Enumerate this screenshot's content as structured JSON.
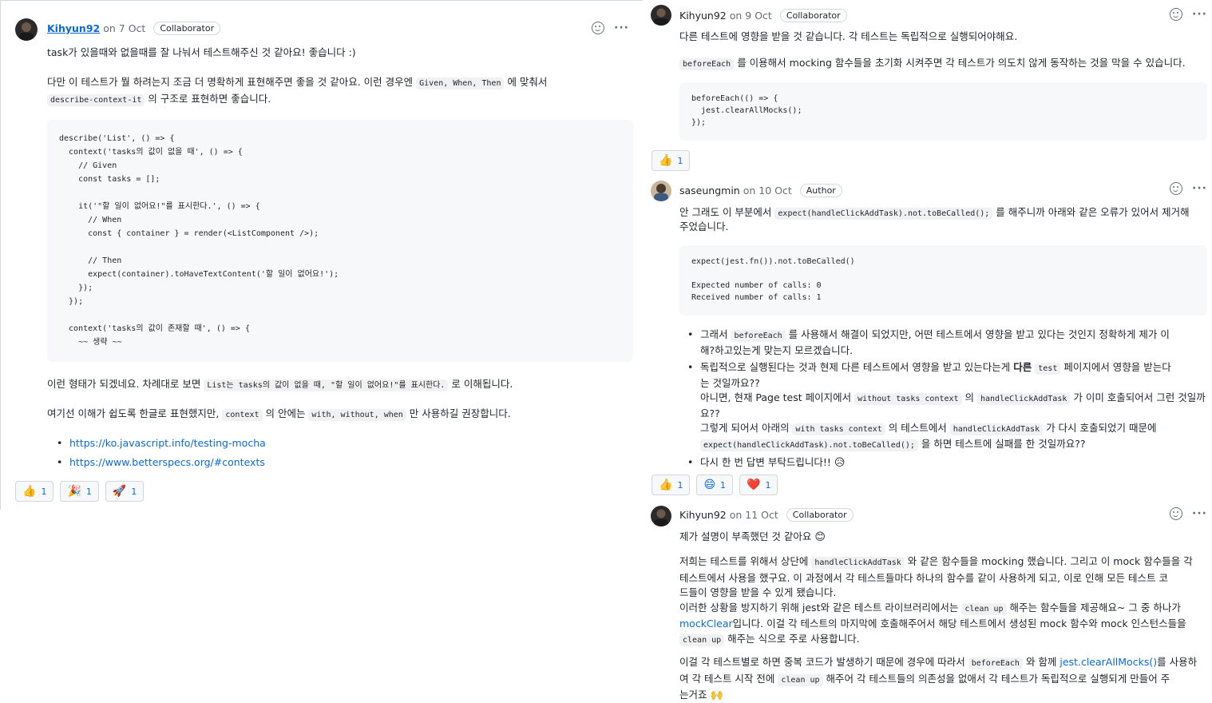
{
  "c1": {
    "author": "Kihyun92",
    "date": "on 7 Oct",
    "role": "Collaborator",
    "p1": "task가 있을때와 없을때를 잘 나눠서 테스트해주신 것 같아요! 좋습니다 :)",
    "p2_a": "다만 이 테스트가 뭘 하려는지 조금 더 명확하게 표현해주면 좋을 것 같아요. 이런 경우엔 ",
    "p2_code": "Given, When, Then",
    "p2_b": " 에 맞춰서",
    "p2_code2": "describe-context-it",
    "p2_c": " 의 구조로 표현하면 좋습니다.",
    "code": "describe('List', () => {\n  context('tasks의 값이 없을 때', () => {\n    // Given\n    const tasks = [];\n\n    it('\"할 일이 없어요!\"를 표시한다.', () => {\n      // When\n      const { container } = render(<ListComponent />);\n\n      // Then\n      expect(container).toHaveTextContent('할 일이 없어요!');\n    });\n  });\n\n  context('tasks의 값이 존재할 때', () => {\n    ~~ 생략 ~~",
    "p3_a": "이런 형태가 되겠네요. 차례대로 보면 ",
    "p3_code": "List는 tasks의 값이 없을 때, \"할 일이 없어요!\"를 표시한다.",
    "p3_b": " 로 이해됩니다.",
    "p4_a": "여기선 이해가 쉽도록 한글로 표현했지만, ",
    "p4_code": "context",
    "p4_b": " 의 안에는 ",
    "p4_code2": "with, without, when",
    "p4_c": " 만 사용하길 권장합니다.",
    "links": [
      "https://ko.javascript.info/testing-mocha",
      "https://www.betterspecs.org/#contexts"
    ],
    "reactions": [
      {
        "emoji": "👍",
        "count": "1"
      },
      {
        "emoji": "🎉",
        "count": "1"
      },
      {
        "emoji": "🚀",
        "count": "1"
      }
    ]
  },
  "c2": {
    "author": "Kihyun92",
    "date": "on 9 Oct",
    "role": "Collaborator",
    "p1": "다른 테스트에 영향을 받을 것 같습니다. 각 테스트는 독립적으로 실행되어야해요.",
    "p2_code": "beforeEach",
    "p2_b": " 를 이용해서 mocking 함수들을 초기화 시켜주면 각 테스트가 의도치 않게 동작하는 것을 막을 수 있습니다.",
    "code": "beforeEach(() => {\n  jest.clearAllMocks();\n});",
    "reactions": [
      {
        "emoji": "👍",
        "count": "1"
      }
    ]
  },
  "c3": {
    "author": "saseungmin",
    "date": "on 10 Oct",
    "role": "Author",
    "p1_a": "안 그래도 이 부분에서 ",
    "p1_code": "expect(handleClickAddTask).not.toBeCalled();",
    "p1_b": " 를 해주니까 아래와 같은 오류가 있어서 제거해",
    "p1_c": "주었습니다.",
    "code": "expect(jest.fn()).not.toBeCalled()\n\nExpected number of calls: 0\nReceived number of calls: 1",
    "b1_a": "그래서 ",
    "b1_code": "beforeEach",
    "b1_b": " 를 사용해서 해결이 되었지만, 어떤 테스트에서 영향을 받고 있다는 것인지 정확하게 제가 이",
    "b1_c": "해?하고있는게 맞는지 모르겠습니다.",
    "b2_a": "독립적으로 실행된다는 것과 현제 다른 테스트에서 영향을 받고 있는다는게 ",
    "b2_bold": "다른",
    "b2_code": "test",
    "b2_b": " 페이지에서 영향을 받는다",
    "b2_c": "는 것일까요??",
    "b2_d": "아니면, 현재 Page test 페이지에서 ",
    "b2_code2": "without tasks context",
    "b2_e": " 의 ",
    "b2_code3": "handleClickAddTask",
    "b2_f": " 가 이미 호출되어서 그런 것일까",
    "b2_g": "요??",
    "b2_h": "그렇게 되어서 아래의 ",
    "b2_code4": "with tasks context",
    "b2_i": " 의 테스트에서 ",
    "b2_code5": "handleClickAddTask",
    "b2_j": " 가 다시 호출되었기 때문에",
    "b2_code6": "expect(handleClickAddTask).not.toBeCalled();",
    "b2_k": " 을 하면 테스트에 실패를 한 것일까요??",
    "b3": "다시 한 번 답변 부탁드립니다!! ",
    "b3_emoji": "😥",
    "reactions": [
      {
        "emoji": "👍",
        "count": "1"
      },
      {
        "emoji": "😄",
        "count": "1"
      },
      {
        "emoji": "❤️",
        "count": "1"
      }
    ]
  },
  "c4": {
    "author": "Kihyun92",
    "date": "on 11 Oct",
    "role": "Collaborator",
    "p1": "제가 설명이 부족했던 것 같아요 ",
    "p1_emoji": "😊",
    "p2_a": "저희는 테스트를 위해서 상단에 ",
    "p2_code": "handleClickAddTask",
    "p2_b": " 와 같은 함수들을 mocking 했습니다. 그리고 이 mock 함수들을 각",
    "p2_c": "테스트에서 사용을 했구요. 이 과정에서 각 테스트들마다 하나의 함수를 같이 사용하게 되고, 이로 인해 모든 테스트 코",
    "p2_d": "드들이 영향을 받을 수 있게 됐습니다.",
    "p2_e": "이러한 상황을 방지하기 위해 jest와 같은 테스트 라이브러리에서는 ",
    "p2_code2": "clean up",
    "p2_f": " 해주는 함수들을 제공해요~ 그 중 하나가",
    "p2_link": "mockClear",
    "p2_g": "입니다. 이걸 각 테스트의 마지막에 호출해주어서 해당 테스트에서 생성된 mock 함수와 mock 인스턴스들을",
    "p2_code3": "clean up",
    "p2_h": " 해주는 식으로 주로 사용합니다.",
    "p3_a": "이걸 각 테스트별로 하면 중복 코드가 발생하기 때문에 경우에 따라서 ",
    "p3_code": "beforeEach",
    "p3_b": " 와 함께 ",
    "p3_link": "jest.clearAllMocks()",
    "p3_c": "를 사용하",
    "p3_d": "여 각 테스트 시작 전에 ",
    "p3_code2": "clean up",
    "p3_e": " 해주어 각 테스트들의 의존성을 없애서 각 테스트가 독립적으로 실행되게 만들어 주",
    "p3_f": "는거죠 ",
    "p3_emoji": "🙌"
  }
}
